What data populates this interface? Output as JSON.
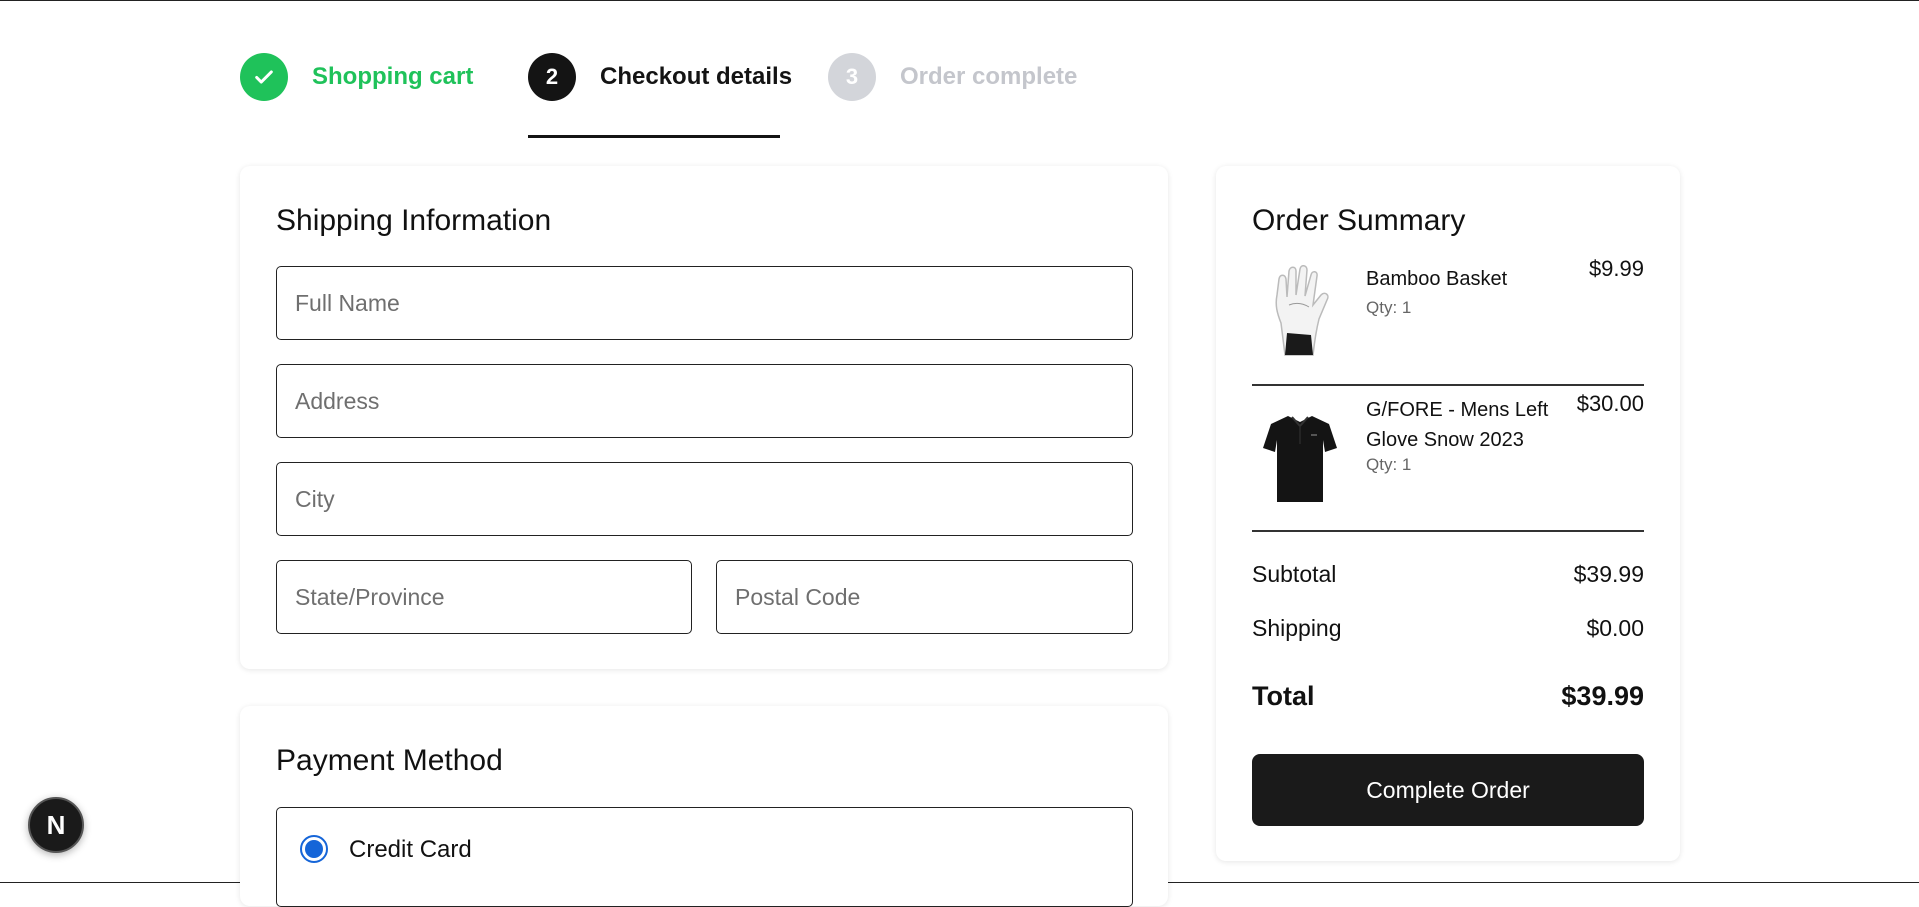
{
  "steps": [
    {
      "number": "",
      "label": "Shopping cart",
      "state": "completed",
      "icon": "check-icon"
    },
    {
      "number": "2",
      "label": "Checkout details",
      "state": "active"
    },
    {
      "number": "3",
      "label": "Order complete",
      "state": "upcoming"
    }
  ],
  "shipping": {
    "title": "Shipping Information",
    "full_name_placeholder": "Full Name",
    "address_placeholder": "Address",
    "city_placeholder": "City",
    "state_placeholder": "State/Province",
    "postal_placeholder": "Postal Code"
  },
  "payment": {
    "title": "Payment Method",
    "options": [
      {
        "label": "Credit Card",
        "selected": true
      }
    ]
  },
  "summary": {
    "title": "Order Summary",
    "items": [
      {
        "name": "Bamboo Basket",
        "qty": "Qty: 1",
        "price": "$9.99",
        "image": "white-golf-glove"
      },
      {
        "name": "G/FORE - Mens Left Glove Snow 2023",
        "qty": "Qty: 1",
        "price": "$30.00",
        "image": "black-polo-shirt"
      }
    ],
    "subtotal_label": "Subtotal",
    "subtotal_value": "$39.99",
    "shipping_label": "Shipping",
    "shipping_value": "$0.00",
    "total_label": "Total",
    "total_value": "$39.99",
    "complete_button": "Complete Order"
  },
  "dev_badge": {
    "letter": "N"
  },
  "colors": {
    "success": "#1fc25a",
    "active": "#141414",
    "inactive": "#d3d5da",
    "radio": "#1565d8",
    "button": "#1a1a1a"
  }
}
